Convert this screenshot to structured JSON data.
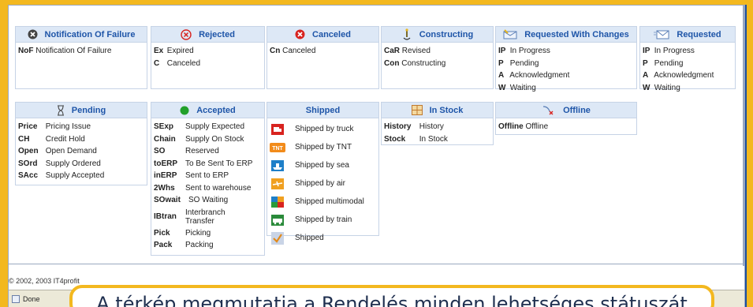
{
  "panels": {
    "nof": {
      "title": "Notification Of Failure",
      "rows": [
        {
          "code": "NoF",
          "label": "Notification Of Failure"
        }
      ]
    },
    "rejected": {
      "title": "Rejected",
      "rows": [
        {
          "code": "Ex",
          "label": "Expired"
        },
        {
          "code": "C",
          "label": "Canceled"
        }
      ]
    },
    "canceled": {
      "title": "Canceled",
      "rows": [
        {
          "code": "Cn",
          "label": "Canceled"
        }
      ]
    },
    "constructing": {
      "title": "Constructing",
      "rows": [
        {
          "code": "CaR",
          "label": "Revised"
        },
        {
          "code": "Con",
          "label": "Constructing"
        }
      ]
    },
    "rwc": {
      "title": "Requested With Changes",
      "rows": [
        {
          "code": "IP",
          "label": "In Progress"
        },
        {
          "code": "P",
          "label": "Pending"
        },
        {
          "code": "A",
          "label": "Acknowledgment"
        },
        {
          "code": "W",
          "label": "Waiting"
        }
      ]
    },
    "requested": {
      "title": "Requested",
      "rows": [
        {
          "code": "IP",
          "label": "In Progress"
        },
        {
          "code": "P",
          "label": "Pending"
        },
        {
          "code": "A",
          "label": "Acknowledgment"
        },
        {
          "code": "W",
          "label": "Waiting"
        }
      ]
    },
    "pending": {
      "title": "Pending",
      "rows": [
        {
          "code": "Price",
          "label": "Pricing Issue"
        },
        {
          "code": "CH",
          "label": "Credit Hold"
        },
        {
          "code": "Open",
          "label": "Open Demand"
        },
        {
          "code": "SOrd",
          "label": "Supply Ordered"
        },
        {
          "code": "SAcc",
          "label": "Supply Accepted"
        }
      ]
    },
    "accepted": {
      "title": "Accepted",
      "rows": [
        {
          "code": "SExp",
          "label": "Supply Expected"
        },
        {
          "code": "Chain",
          "label": "Supply On Stock"
        },
        {
          "code": "SO",
          "label": "Reserved"
        },
        {
          "code": "toERP",
          "label": "To Be Sent To ERP"
        },
        {
          "code": "inERP",
          "label": "Sent to ERP"
        },
        {
          "code": "2Whs",
          "label": "Sent to warehouse"
        },
        {
          "code": "SOwait",
          "label": "SO Waiting"
        },
        {
          "code": "IBtran",
          "label": "Interbranch Transfer"
        },
        {
          "code": "Pick",
          "label": "Picking"
        },
        {
          "code": "Pack",
          "label": "Packing"
        }
      ]
    },
    "shipped": {
      "title": "Shipped",
      "rows": [
        {
          "icon": "truck-icon",
          "label": "Shipped by truck"
        },
        {
          "icon": "tnt-icon",
          "label": "Shipped by TNT"
        },
        {
          "icon": "ship-icon",
          "label": "Shipped by sea"
        },
        {
          "icon": "plane-icon",
          "label": "Shipped by air"
        },
        {
          "icon": "multimodal-icon",
          "label": "Shipped multimodal"
        },
        {
          "icon": "train-icon",
          "label": "Shipped by train"
        },
        {
          "icon": "check-icon",
          "label": "Shipped"
        }
      ]
    },
    "instock": {
      "title": "In Stock",
      "rows": [
        {
          "code": "History",
          "label": "History"
        },
        {
          "code": "Stock",
          "label": "In Stock"
        }
      ]
    },
    "offline": {
      "title": "Offline",
      "rows": [
        {
          "code": "Offline",
          "label": "Offline"
        }
      ]
    }
  },
  "footer": {
    "copyright": "© 2002, 2003 IT4profit",
    "status": "Done"
  },
  "caption": "A térkép megmutatja a Rendelés minden lehetséges státuszát"
}
